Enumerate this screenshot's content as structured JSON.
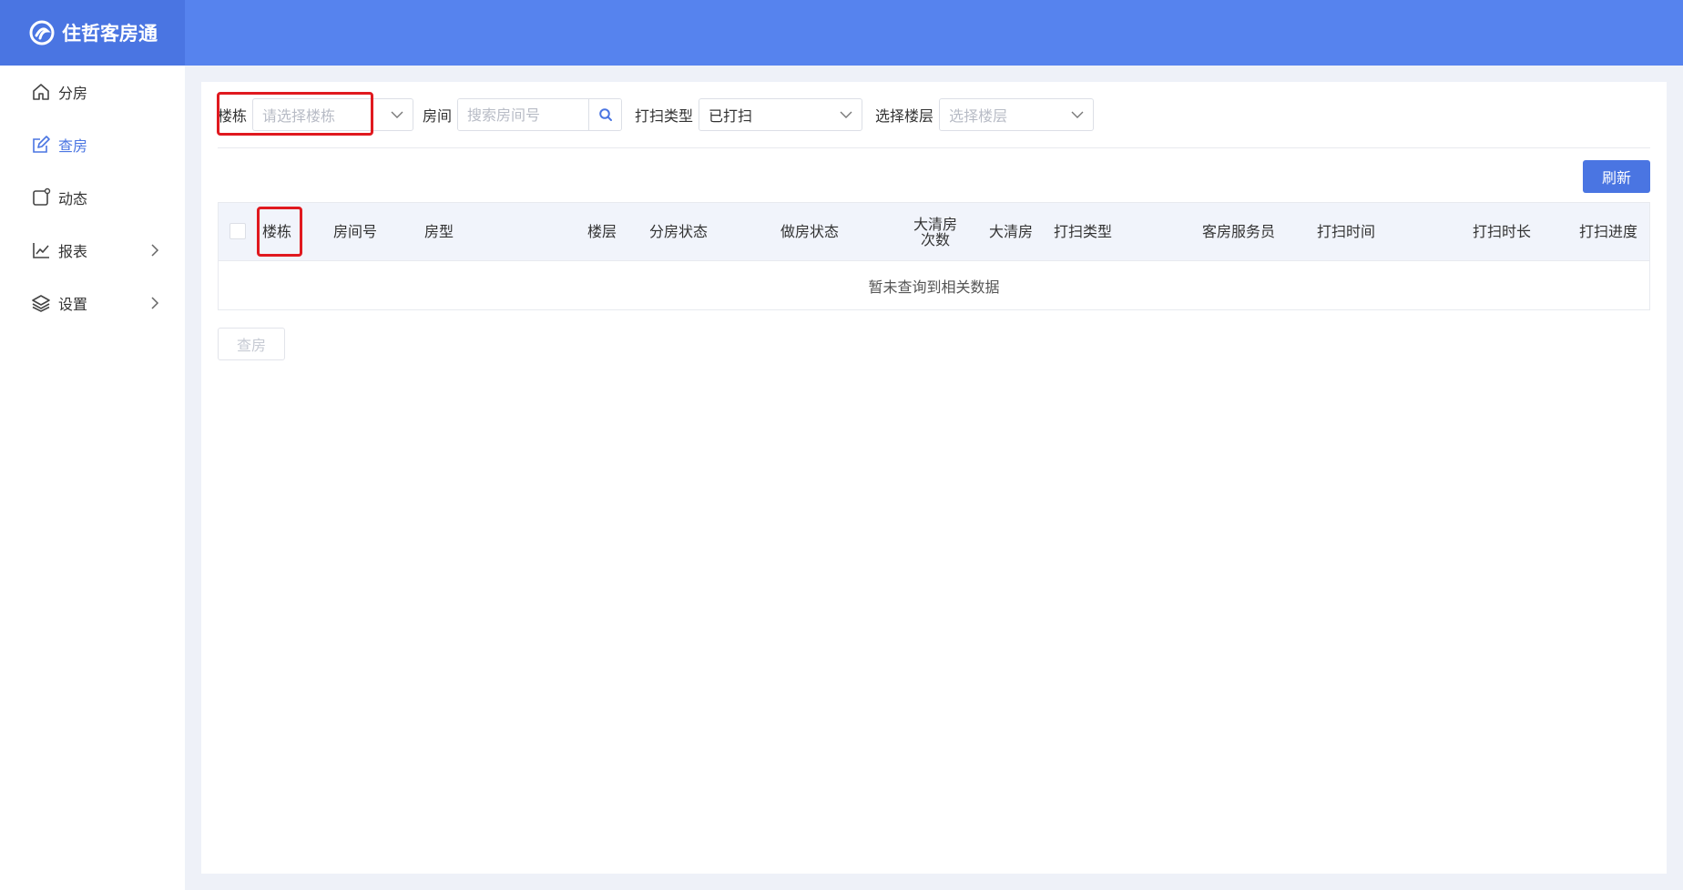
{
  "app": {
    "title": "住哲客房通"
  },
  "sidebar": {
    "items": [
      {
        "label": "分房",
        "icon": "home-icon"
      },
      {
        "label": "查房",
        "icon": "edit-icon"
      },
      {
        "label": "动态",
        "icon": "square-icon"
      },
      {
        "label": "报表",
        "icon": "chart-icon"
      },
      {
        "label": "设置",
        "icon": "layers-icon"
      }
    ],
    "active_index": 1
  },
  "filters": {
    "building_label": "楼栋",
    "building_placeholder": "请选择楼栋",
    "room_label": "房间",
    "room_placeholder": "搜索房间号",
    "clean_type_label": "打扫类型",
    "clean_type_value": "已打扫",
    "floor_label": "选择楼层",
    "floor_placeholder": "选择楼层"
  },
  "toolbar": {
    "refresh_label": "刷新"
  },
  "table": {
    "columns": [
      "楼栋",
      "房间号",
      "房型",
      "楼层",
      "分房状态",
      "做房状态",
      "大清房次数",
      "大清房",
      "打扫类型",
      "客房服务员",
      "打扫时间",
      "打扫时长",
      "打扫进度"
    ],
    "empty_text": "暂未查询到相关数据"
  },
  "actions": {
    "check_room_label": "查房"
  },
  "colors": {
    "header": "#5683ee",
    "brand": "#4a75e2",
    "accent": "#4a75e2",
    "highlight": "#e0191f"
  }
}
